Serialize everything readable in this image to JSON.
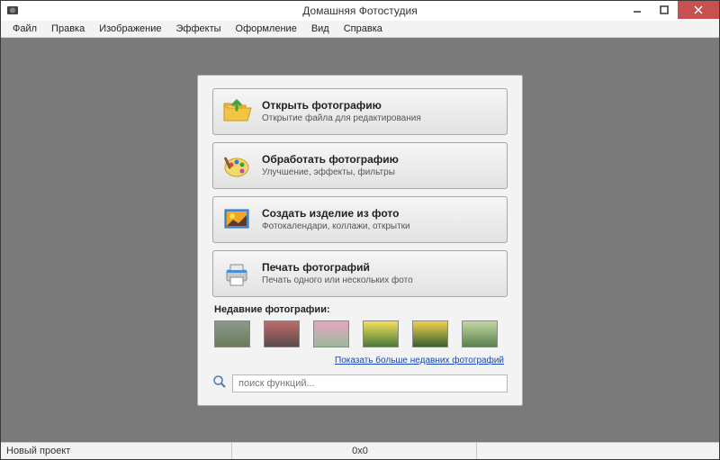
{
  "window": {
    "title": "Домашняя Фотостудия"
  },
  "menu": {
    "file": "Файл",
    "edit": "Правка",
    "image": "Изображение",
    "effects": "Эффекты",
    "design": "Оформление",
    "view": "Вид",
    "help": "Справка"
  },
  "actions": {
    "open": {
      "title": "Открыть фотографию",
      "sub": "Открытие файла для редактирования"
    },
    "process": {
      "title": "Обработать фотографию",
      "sub": "Улучшение, эффекты, фильтры"
    },
    "create": {
      "title": "Создать изделие из фото",
      "sub": "Фотокалендари, коллажи, открытки"
    },
    "print": {
      "title": "Печать фотографий",
      "sub": "Печать одного или нескольких фото"
    }
  },
  "recent": {
    "label": "Недавние фотографии:",
    "show_more": "Показать больше недавних фотографий"
  },
  "search": {
    "placeholder": "поиск функций..."
  },
  "status": {
    "project": "Новый проект",
    "dims": "0x0"
  }
}
